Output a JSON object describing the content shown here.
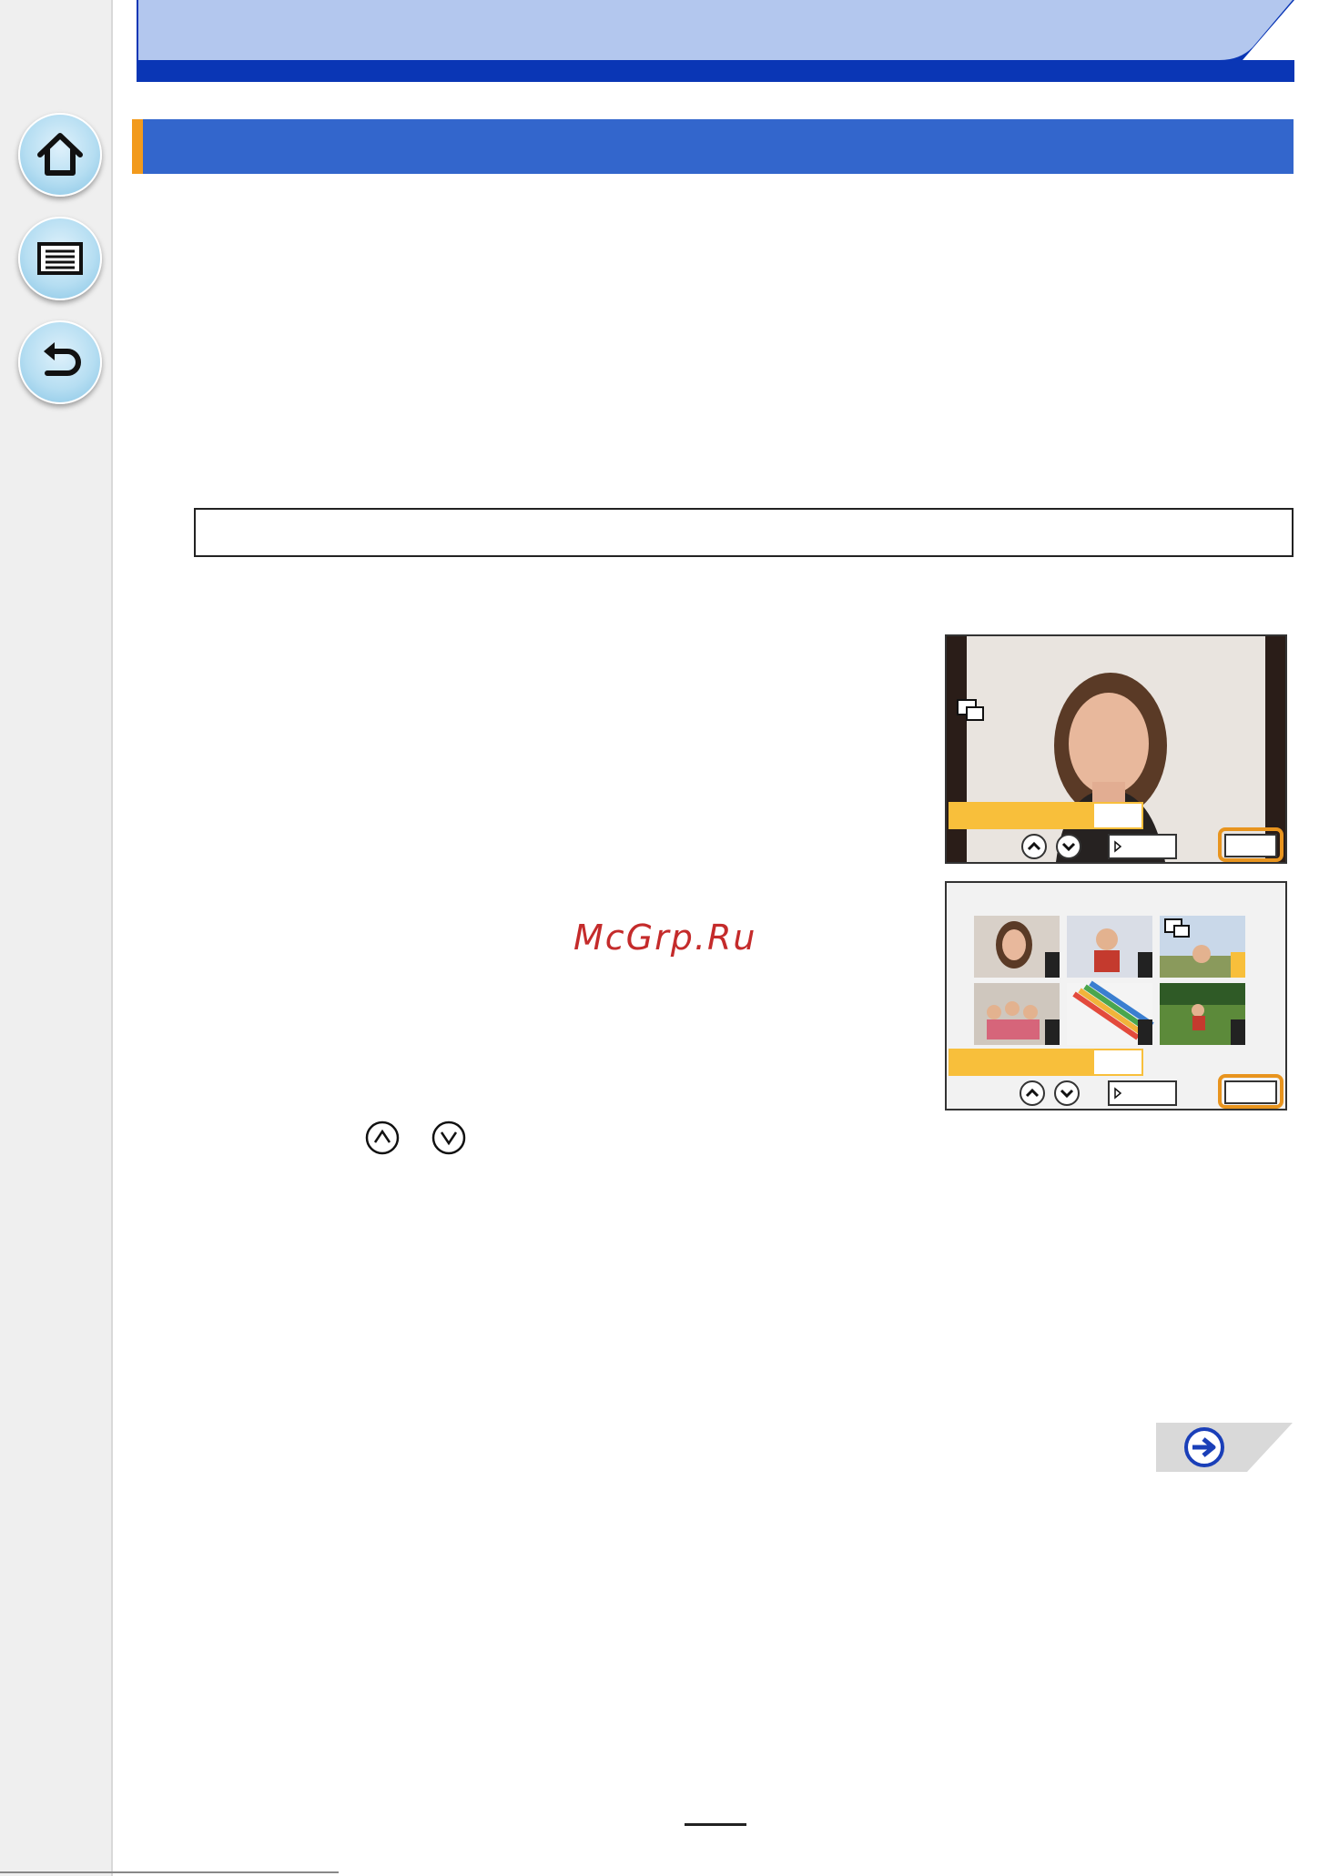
{
  "watermark": {
    "text": "McGrp.Ru"
  },
  "sidebar": {
    "items": [
      {
        "icon": "home-icon"
      },
      {
        "icon": "list-icon"
      },
      {
        "icon": "return-icon"
      }
    ]
  },
  "colors": {
    "header_light": "#b3c7ee",
    "header_dark": "#0a36b5",
    "section_bar": "#3366cc",
    "section_accent": "#f29a1c",
    "highlight": "#f8bf3b",
    "button_outline": "#e8941e",
    "watermark": "#c42b2b"
  },
  "icons": {
    "up_key": "up-arrow-circle-icon",
    "down_key": "down-arrow-circle-icon",
    "next_page": "next-page-arrow-icon",
    "print_mark": "print-set-icon"
  }
}
